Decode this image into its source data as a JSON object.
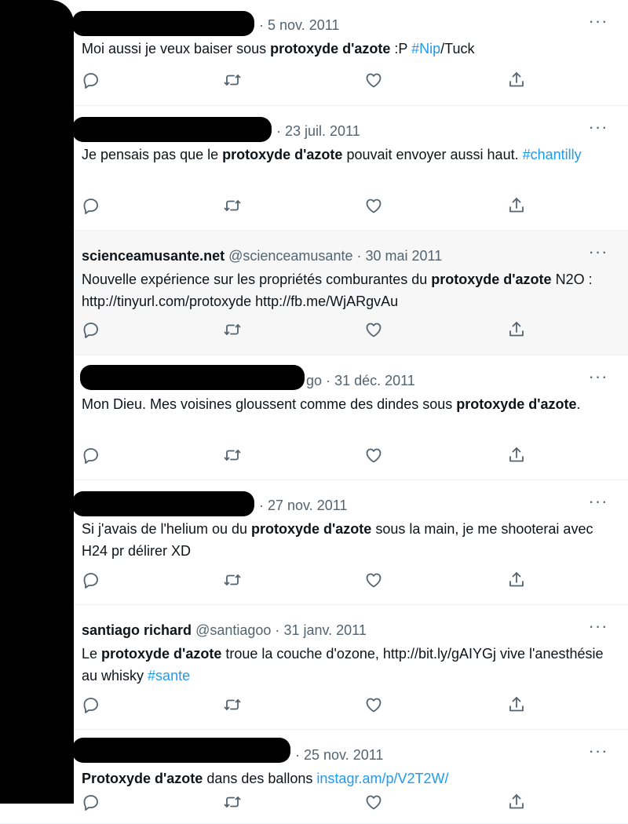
{
  "tweets": [
    {
      "name": "",
      "handle": "",
      "date": "5 nov. 2011",
      "body": [
        {
          "t": "Moi aussi je veux baiser sous "
        },
        {
          "t": "protoxyde d'azote",
          "b": true
        },
        {
          "t": " :P "
        },
        {
          "t": "#Nip",
          "link": true
        },
        {
          "t": "/Tuck"
        }
      ]
    },
    {
      "name": "",
      "handle": "",
      "date": "23 juil. 2011",
      "body": [
        {
          "t": "Je pensais pas que le "
        },
        {
          "t": "protoxyde d'azote",
          "b": true
        },
        {
          "t": " pouvait envoyer aussi haut. "
        },
        {
          "t": "#chantilly",
          "link": true
        }
      ]
    },
    {
      "name": "scienceamusante.net",
      "handle": "@scienceamusante",
      "date": "30 mai 2011",
      "body": [
        {
          "t": "Nouvelle expérience sur les propriétés comburantes du "
        },
        {
          "t": "protoxyde d'azote",
          "b": true
        },
        {
          "t": " N2O : http://tinyurl.com/protoxyde http://fb.me/WjARgvAu"
        }
      ]
    },
    {
      "name": "",
      "handle": "go",
      "date": "31 déc. 2011",
      "body": [
        {
          "t": "Mon Dieu. Mes voisines gloussent comme des dindes sous "
        },
        {
          "t": "protoxyde d'azote",
          "b": true
        },
        {
          "t": "."
        }
      ]
    },
    {
      "name": "",
      "handle": "",
      "date": "27 nov. 2011",
      "body": [
        {
          "t": "Si j'avais de l'helium ou du "
        },
        {
          "t": "protoxyde d'azote",
          "b": true
        },
        {
          "t": " sous la main, je me shooterai avec H24 pr délirer XD"
        }
      ]
    },
    {
      "name": "santiago richard",
      "handle": "@santiagoo",
      "date": "31 janv. 2011",
      "body": [
        {
          "t": "Le "
        },
        {
          "t": "protoxyde d'azote",
          "b": true
        },
        {
          "t": " troue la couche d'ozone, http://bit.ly/gAIYGj vive l'anesthésie au whisky "
        },
        {
          "t": "#sante",
          "link": true
        }
      ]
    },
    {
      "name": "",
      "handle": "",
      "date": "25 nov. 2011",
      "body": [
        {
          "t": "Protoxyde d'azote",
          "b": true
        },
        {
          "t": " dans des ballons "
        },
        {
          "t": "instagr.am/p/V2T2W/",
          "link": true
        }
      ]
    }
  ],
  "ui": {
    "more_label": "···",
    "separator": "·",
    "icons": [
      "reply-icon",
      "retweet-icon",
      "like-icon",
      "share-icon",
      "more-icon"
    ],
    "colors": {
      "link": "#1d9bf0",
      "muted": "#536471",
      "text": "#0f1419",
      "highlight": "#f7f7f7"
    }
  }
}
